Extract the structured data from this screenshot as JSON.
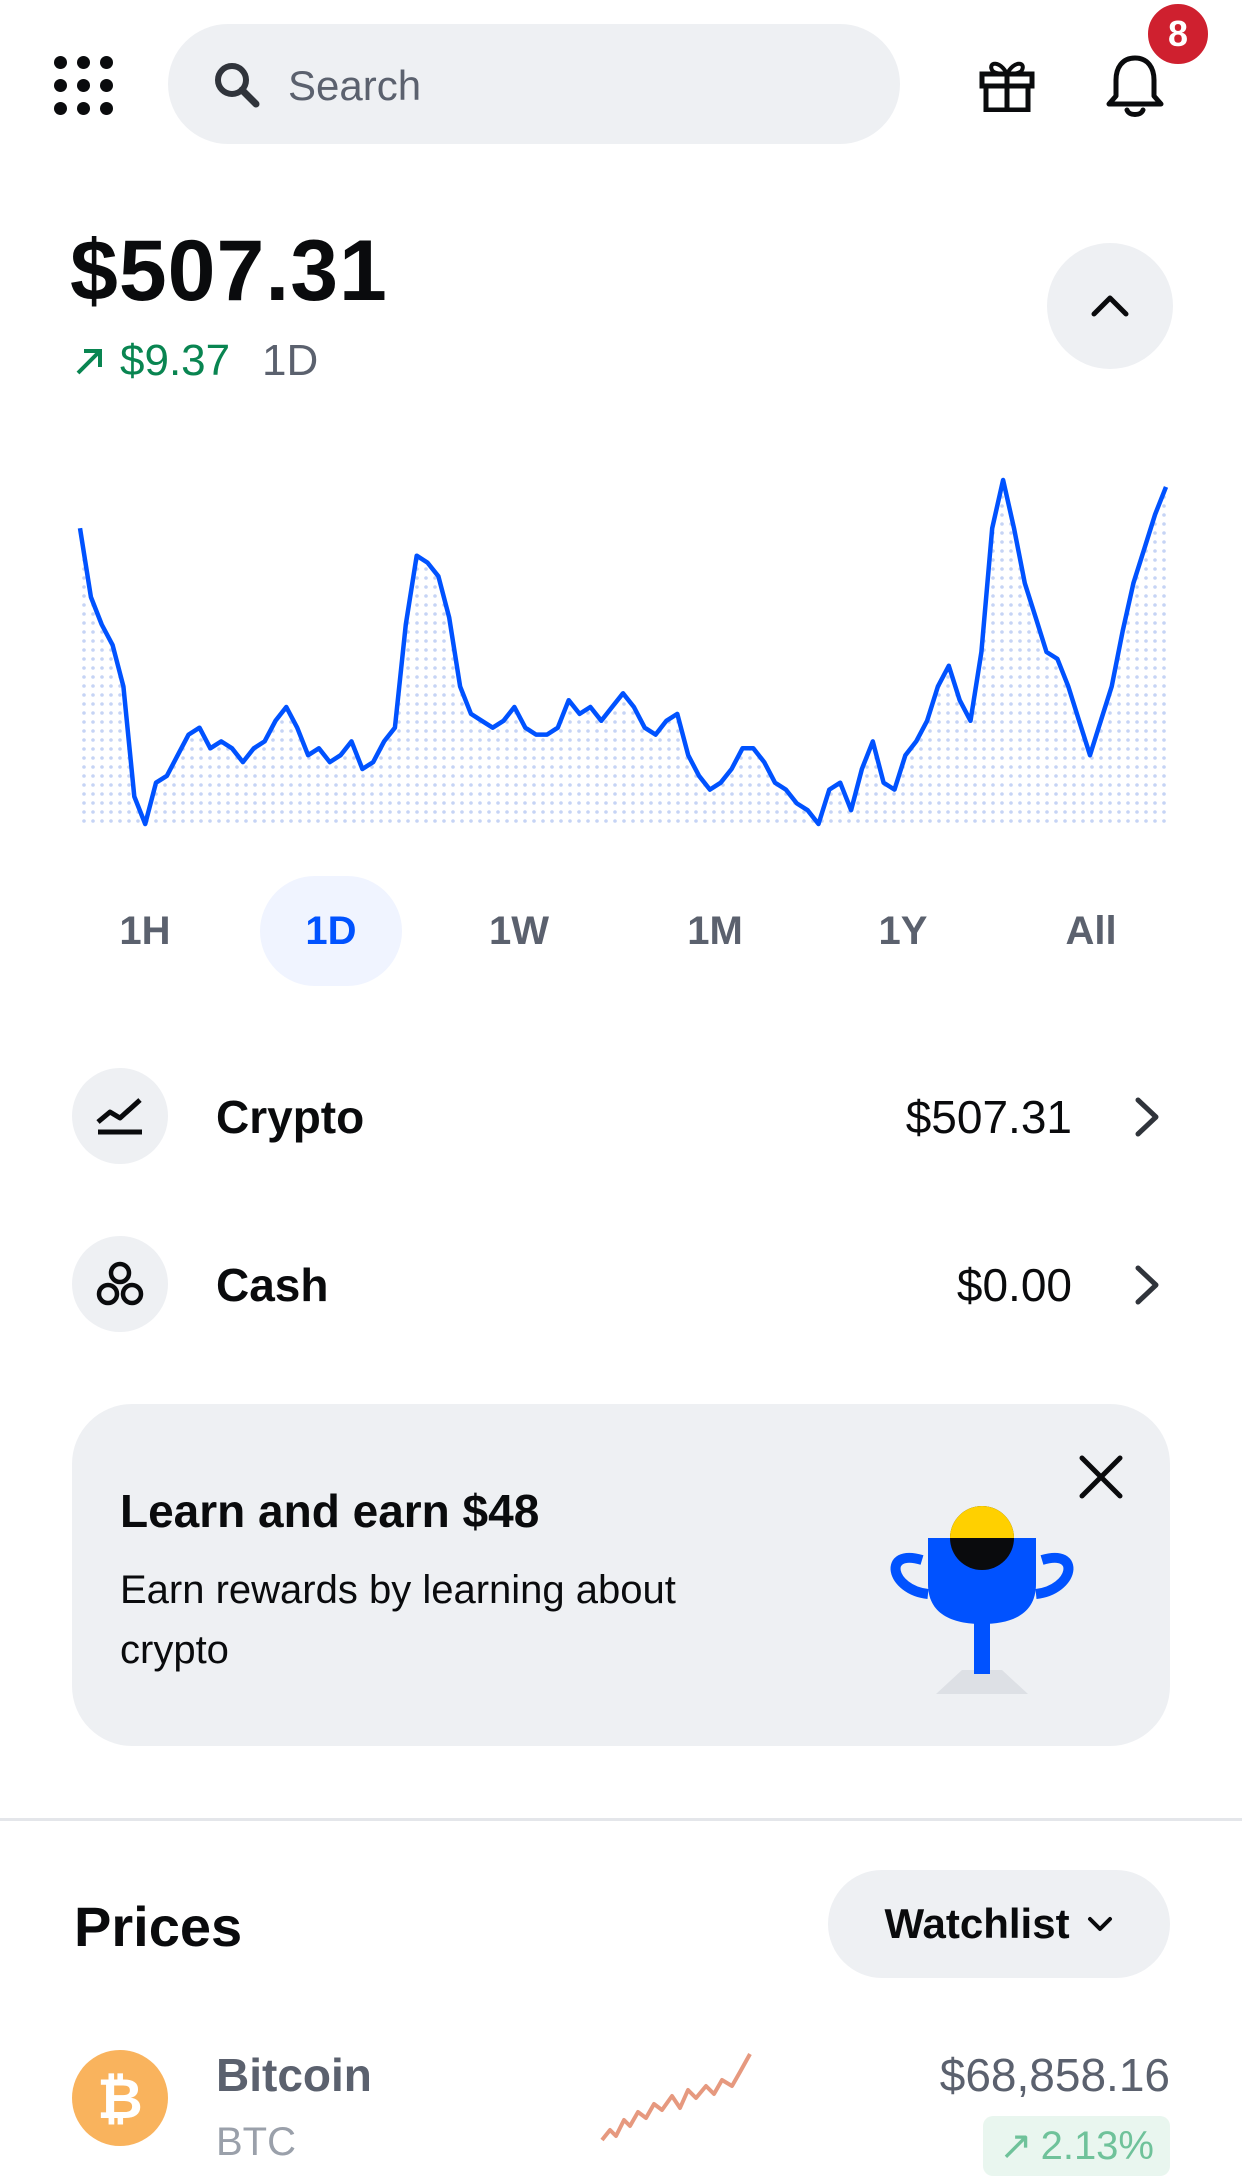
{
  "header": {
    "search_placeholder": "Search",
    "notification_count": "8"
  },
  "portfolio": {
    "balance": "$507.31",
    "change_value": "$9.37",
    "change_period": "1D",
    "change_direction": "up",
    "change_color": "#098551"
  },
  "chart_data": {
    "type": "area",
    "x": [
      0,
      1,
      2,
      3,
      4,
      5,
      6,
      7,
      8,
      9,
      10,
      11,
      12,
      13,
      14,
      15,
      16,
      17,
      18,
      19,
      20,
      21,
      22,
      23,
      24,
      25,
      26,
      27,
      28,
      29,
      30,
      31,
      32,
      33,
      34,
      35,
      36,
      37,
      38,
      39,
      40,
      41,
      42,
      43,
      44,
      45,
      46,
      47,
      48,
      49,
      50,
      51,
      52,
      53,
      54,
      55,
      56,
      57,
      58,
      59,
      60,
      61,
      62,
      63,
      64,
      65,
      66,
      67,
      68,
      69,
      70,
      71,
      72,
      73,
      74,
      75,
      76,
      77,
      78,
      79,
      80,
      81,
      82,
      83,
      84,
      85,
      86,
      87,
      88,
      89,
      90,
      91,
      92,
      93,
      94,
      95,
      96,
      97,
      98,
      99,
      100
    ],
    "values": [
      86,
      66,
      58,
      52,
      40,
      8,
      0,
      12,
      14,
      20,
      26,
      28,
      22,
      24,
      22,
      18,
      22,
      24,
      30,
      34,
      28,
      20,
      22,
      18,
      20,
      24,
      16,
      18,
      24,
      28,
      58,
      78,
      76,
      72,
      60,
      40,
      32,
      30,
      28,
      30,
      34,
      28,
      26,
      26,
      28,
      36,
      32,
      34,
      30,
      34,
      38,
      34,
      28,
      26,
      30,
      32,
      20,
      14,
      10,
      12,
      16,
      22,
      22,
      18,
      12,
      10,
      6,
      4,
      0,
      10,
      12,
      4,
      16,
      24,
      12,
      10,
      20,
      24,
      30,
      40,
      46,
      36,
      30,
      50,
      86,
      100,
      86,
      70,
      60,
      50,
      48,
      40,
      30,
      20,
      30,
      40,
      56,
      70,
      80,
      90,
      98
    ],
    "line_color": "#0052ff",
    "fill": "dotted",
    "xlabel": "",
    "ylabel": "",
    "grid": false,
    "legend": "none"
  },
  "range_tabs": {
    "items": [
      "1H",
      "1D",
      "1W",
      "1M",
      "1Y",
      "All"
    ],
    "selected": "1D"
  },
  "accounts": [
    {
      "label": "Crypto",
      "value": "$507.31",
      "icon": "chart-line-icon"
    },
    {
      "label": "Cash",
      "value": "$0.00",
      "icon": "coins-icon"
    }
  ],
  "promo": {
    "title": "Learn and earn $48",
    "body": "Earn rewards by learning about crypto",
    "illustration": "trophy-icon"
  },
  "prices": {
    "title": "Prices",
    "filter_label": "Watchlist",
    "assets": [
      {
        "name": "Bitcoin",
        "symbol": "BTC",
        "price": "$68,858.16",
        "change": "2.13%",
        "direction": "up",
        "coin_color": "#f7931a",
        "spark_color": "#e0805f"
      }
    ]
  },
  "colors": {
    "accent": "#0052ff",
    "positive": "#098551",
    "badge": "#cf202f",
    "surface": "#eef0f3"
  }
}
